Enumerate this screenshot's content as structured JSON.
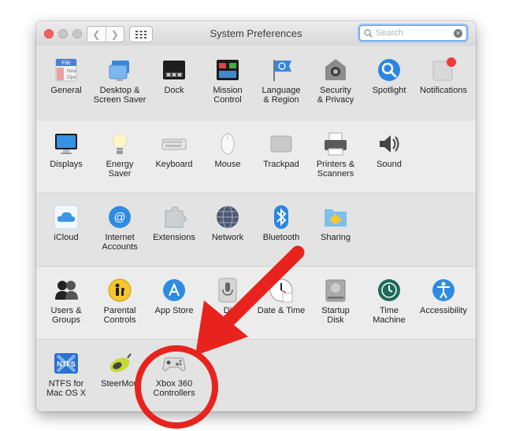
{
  "window": {
    "title": "System Preferences"
  },
  "search": {
    "placeholder": "Search"
  },
  "rows": [
    {
      "items": [
        {
          "id": "general",
          "label": "General",
          "icon": "general-icon"
        },
        {
          "id": "desktop",
          "label": "Desktop &\nScreen Saver",
          "icon": "desktop-icon"
        },
        {
          "id": "dock",
          "label": "Dock",
          "icon": "dock-icon"
        },
        {
          "id": "mission",
          "label": "Mission\nControl",
          "icon": "mission-control-icon"
        },
        {
          "id": "language",
          "label": "Language\n& Region",
          "icon": "language-icon"
        },
        {
          "id": "security",
          "label": "Security\n& Privacy",
          "icon": "security-icon"
        },
        {
          "id": "spotlight",
          "label": "Spotlight",
          "icon": "spotlight-icon"
        },
        {
          "id": "notifications",
          "label": "Notifications",
          "icon": "notifications-icon"
        }
      ]
    },
    {
      "items": [
        {
          "id": "displays",
          "label": "Displays",
          "icon": "displays-icon"
        },
        {
          "id": "energy",
          "label": "Energy\nSaver",
          "icon": "energy-icon"
        },
        {
          "id": "keyboard",
          "label": "Keyboard",
          "icon": "keyboard-icon"
        },
        {
          "id": "mouse",
          "label": "Mouse",
          "icon": "mouse-icon"
        },
        {
          "id": "trackpad",
          "label": "Trackpad",
          "icon": "trackpad-icon"
        },
        {
          "id": "printers",
          "label": "Printers &\nScanners",
          "icon": "printer-icon"
        },
        {
          "id": "sound",
          "label": "Sound",
          "icon": "sound-icon"
        }
      ]
    },
    {
      "items": [
        {
          "id": "icloud",
          "label": "iCloud",
          "icon": "icloud-icon"
        },
        {
          "id": "internet",
          "label": "Internet\nAccounts",
          "icon": "internet-accounts-icon"
        },
        {
          "id": "extensions",
          "label": "Extensions",
          "icon": "extensions-icon"
        },
        {
          "id": "network",
          "label": "Network",
          "icon": "network-icon"
        },
        {
          "id": "bluetooth",
          "label": "Bluetooth",
          "icon": "bluetooth-icon"
        },
        {
          "id": "sharing",
          "label": "Sharing",
          "icon": "sharing-icon"
        }
      ]
    },
    {
      "items": [
        {
          "id": "users",
          "label": "Users &\nGroups",
          "icon": "users-icon"
        },
        {
          "id": "parental",
          "label": "Parental\nControls",
          "icon": "parental-controls-icon"
        },
        {
          "id": "appstore",
          "label": "App Store",
          "icon": "app-store-icon"
        },
        {
          "id": "dictation",
          "label": "Di\n&",
          "icon": "microphone-icon"
        },
        {
          "id": "datetime",
          "label": "Date & Time",
          "icon": "clock-icon"
        },
        {
          "id": "startup",
          "label": "Startup\nDisk",
          "icon": "startup-disk-icon"
        },
        {
          "id": "timemachine",
          "label": "Time\nMachine",
          "icon": "time-machine-icon"
        },
        {
          "id": "accessibility",
          "label": "Accessibility",
          "icon": "accessibility-icon"
        }
      ]
    },
    {
      "items": [
        {
          "id": "ntfs",
          "label": "NTFS for\nMac OS X",
          "icon": "ntfs-icon",
          "badge": "NTFS"
        },
        {
          "id": "steermouse",
          "label": "SteerMou",
          "icon": "steermouse-icon"
        },
        {
          "id": "xbox",
          "label": "Xbox 360\nControllers",
          "icon": "gamepad-icon"
        }
      ]
    }
  ],
  "general_icon_text": [
    "File",
    "New",
    "Ope"
  ],
  "accent_colors": {
    "annotation": "#e8231e",
    "search_focus": "#6aa0ea",
    "close": "#fc605c"
  }
}
